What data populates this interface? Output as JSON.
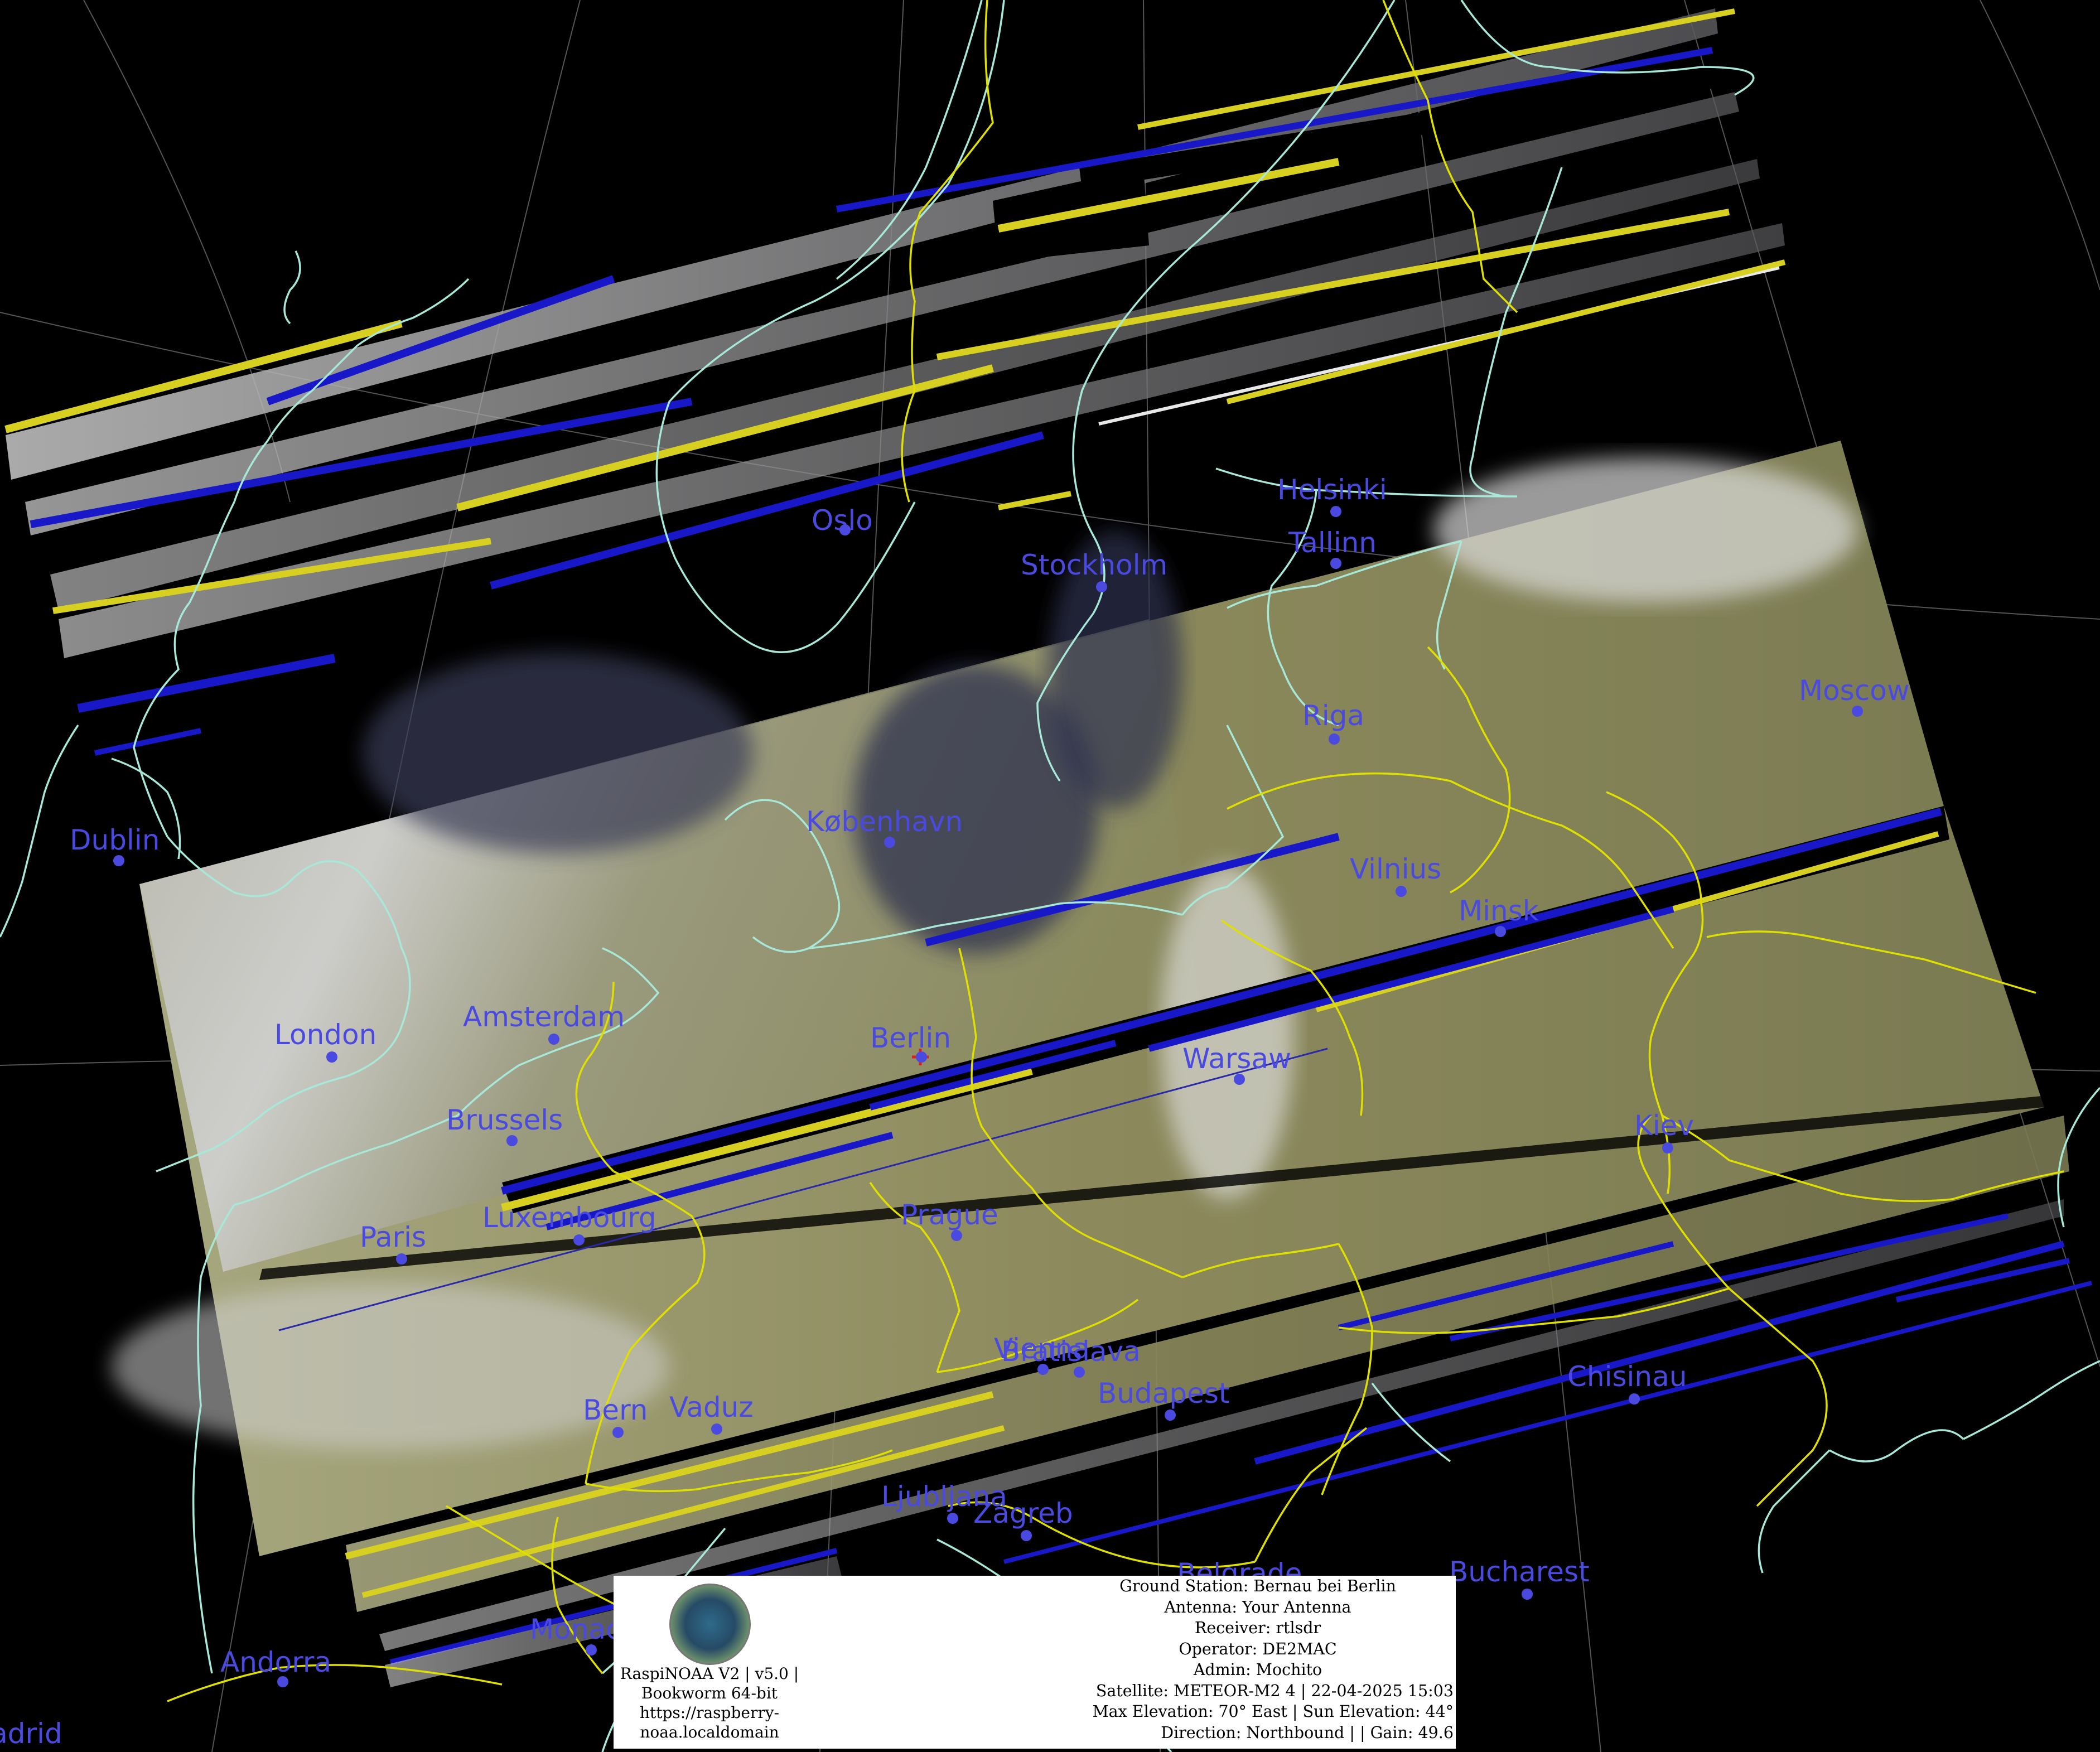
{
  "cities": [
    {
      "id": "oslo",
      "name": "Oslo"
    },
    {
      "id": "stockholm",
      "name": "Stockholm"
    },
    {
      "id": "helsinki",
      "name": "Helsinki"
    },
    {
      "id": "tallinn",
      "name": "Tallinn"
    },
    {
      "id": "riga",
      "name": "Riga"
    },
    {
      "id": "moscow",
      "name": "Moscow"
    },
    {
      "id": "dublin",
      "name": "Dublin"
    },
    {
      "id": "kobenhavn",
      "name": "København"
    },
    {
      "id": "vilnius",
      "name": "Vilnius"
    },
    {
      "id": "minsk",
      "name": "Minsk"
    },
    {
      "id": "london",
      "name": "London"
    },
    {
      "id": "amsterdam",
      "name": "Amsterdam"
    },
    {
      "id": "berlin",
      "name": "Berlin"
    },
    {
      "id": "warsaw",
      "name": "Warsaw"
    },
    {
      "id": "brussels",
      "name": "Brussels"
    },
    {
      "id": "kiev",
      "name": "Kiev"
    },
    {
      "id": "paris",
      "name": "Paris"
    },
    {
      "id": "luxembourg",
      "name": "Luxembourg"
    },
    {
      "id": "prague",
      "name": "Prague"
    },
    {
      "id": "vienna",
      "name": "Vienna"
    },
    {
      "id": "bratislava",
      "name": "Bratislava"
    },
    {
      "id": "chisinau",
      "name": "Chisinau"
    },
    {
      "id": "budapest",
      "name": "Budapest"
    },
    {
      "id": "bern",
      "name": "Bern"
    },
    {
      "id": "vaduz",
      "name": "Vaduz"
    },
    {
      "id": "ljubljana",
      "name": "Ljubljana"
    },
    {
      "id": "zagreb",
      "name": "Zagreb"
    },
    {
      "id": "belgrade",
      "name": "Belgrade"
    },
    {
      "id": "bucharest",
      "name": "Bucharest"
    },
    {
      "id": "andorra",
      "name": "Andorra"
    },
    {
      "id": "monaco",
      "name": "Monaco"
    },
    {
      "id": "madrid",
      "name": "Madrid"
    }
  ],
  "ground_station_marker": "Berlin",
  "logo_caption": [
    "RaspiNOAA V2 | v5.0 |",
    "Bookworm 64-bit",
    "https://raspberry-",
    "noaa.localdomain"
  ],
  "station_info": {
    "ground_station": "Ground Station: Bernau bei Berlin",
    "antenna": "Antenna: Your Antenna",
    "receiver": "Receiver: rtlsdr",
    "operator": "Operator: DE2MAC",
    "admin": "Admin: Mochito",
    "satellite": "Satellite: METEOR-M2 4 | 22-04-2025 15:03",
    "elevation": "Max Elevation: 70° East | Sun Elevation: 44°",
    "direction": "Direction: Northbound | | Gain: 49.6"
  },
  "colors": {
    "city_label": "#4a4ae0",
    "coastline": "#a8e8d8",
    "border": "#e0e000",
    "graticule": "#9a9a9a",
    "marker": "#e02020",
    "background": "#000000"
  }
}
